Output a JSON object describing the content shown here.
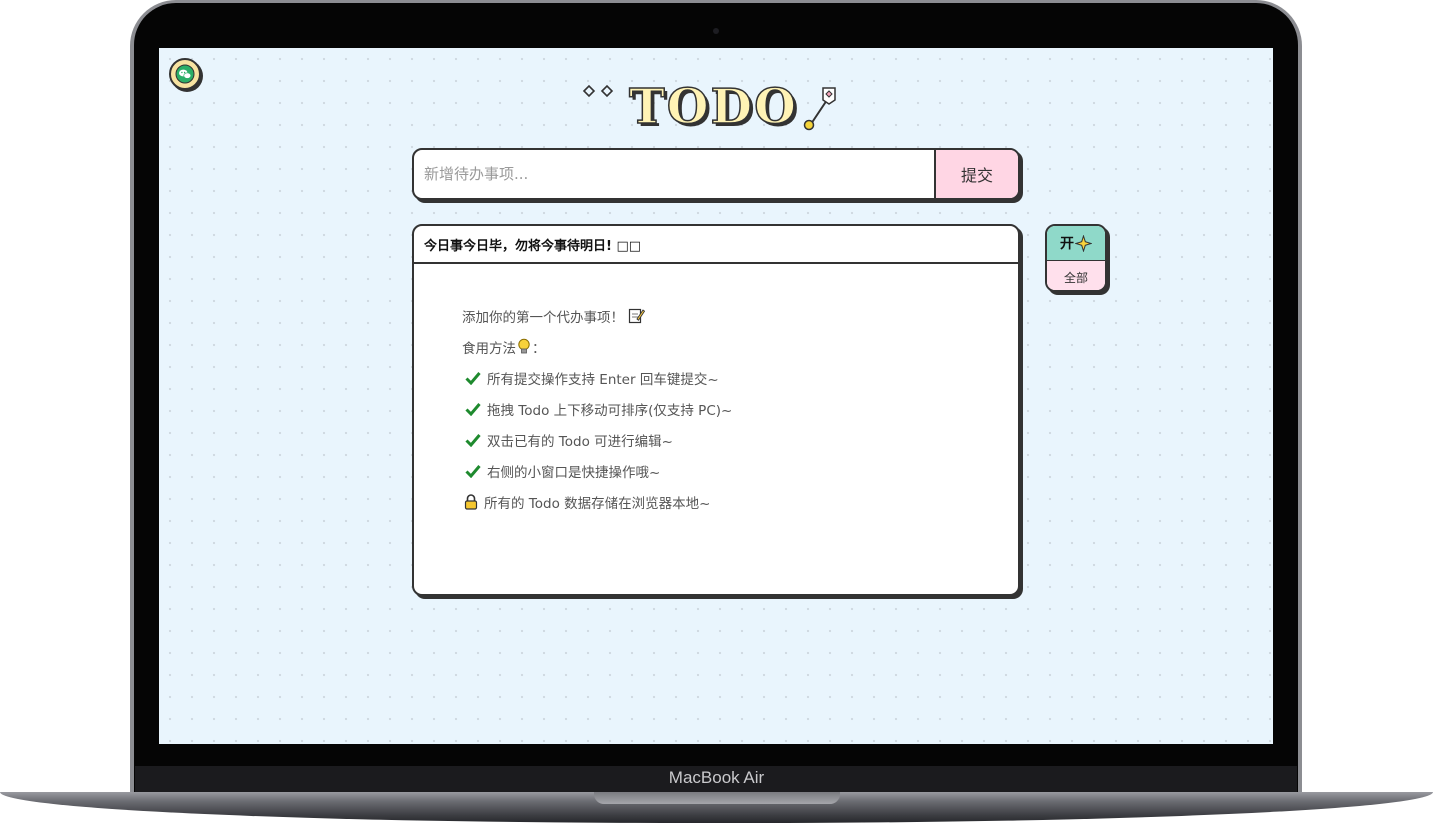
{
  "device": {
    "brand_label": "MacBook Air"
  },
  "header": {
    "logo_text": "TODO"
  },
  "add_form": {
    "placeholder": "新增待办事项...",
    "submit_label": "提交"
  },
  "card": {
    "title": "今日事今日毕，勿将今事待明日! □□",
    "lines": [
      {
        "icon": "memo-icon",
        "text": "添加你的第一个代办事项！"
      },
      {
        "icon": "bulb-icon",
        "text": "食用方法",
        "suffix": "："
      },
      {
        "icon": "check-icon",
        "text": "所有提交操作支持 Enter 回车键提交~"
      },
      {
        "icon": "check-icon",
        "text": "拖拽 Todo 上下移动可排序(仅支持 PC)~"
      },
      {
        "icon": "check-icon",
        "text": "双击已有的 Todo 可进行编辑~"
      },
      {
        "icon": "check-icon",
        "text": "右侧的小窗口是快捷操作哦~"
      },
      {
        "icon": "lock-icon",
        "text": "所有的 Todo 数据存储在浏览器本地~"
      }
    ]
  },
  "side_panel": {
    "toggle_label": "开",
    "filter_label": "全部"
  },
  "colors": {
    "screen_bg": "#e9f5fd",
    "submit_bg": "#ffd6e4",
    "toggle_bg": "#8fd9c9",
    "filter_bg": "#ffe0ec",
    "check_green": "#1e8a2e"
  }
}
